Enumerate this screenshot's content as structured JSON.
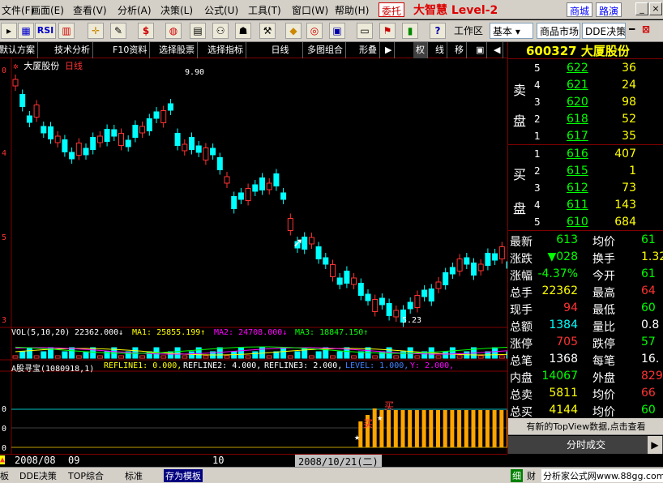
{
  "menubar": {
    "items": [
      "文件(F)",
      "画面(E)",
      "查看(V)",
      "分析(A)",
      "决策(L)",
      "公式(U)",
      "工具(T)",
      "窗口(W)",
      "帮助(H)"
    ],
    "entrust": "委托",
    "brand_title": "大智慧 Level-2",
    "mall": "商城",
    "roadshow": "路演"
  },
  "toolbar": {
    "rsi": "RSI",
    "dollar": "$",
    "workspace": "工作区",
    "basic_select": "基本",
    "market_select": "商品市场",
    "dde_select": "DDE决策"
  },
  "funcbar": {
    "items": [
      "默认方案",
      "技术分析",
      "F10资料",
      "选择股票",
      "选择指标",
      "日线",
      "多图组合",
      "形叠",
      "▶",
      "权",
      "线",
      "移",
      "▣",
      "◀"
    ]
  },
  "chart": {
    "stock_name": "大厦股份",
    "period": "日线",
    "high_label": "9.90",
    "low_label": "5.23",
    "axis_left_top": "0",
    "axis_left_mid": "4",
    "axis_left_lower": "5",
    "axis_left_bottom": "3",
    "vol_title": "VOL(5,10,20)",
    "vol_value": "22362.000↓",
    "ma1": "MA1: 25855.199↑",
    "ma2": "MA2: 24708.000↓",
    "ma3": "MA3: 18847.150↑",
    "ind_title": "A股寻宝(1080918,1)",
    "ref1": "REFLINE1: 0.000,",
    "ref2": "REFLINE2: 4.000,",
    "ref3": "REFLINE3: 2.000,",
    "level": "LEVEL: 1.000,",
    "y": "Y: 2.000,",
    "buy1": "买",
    "buy2": "买",
    "ind_axis_top": "0",
    "ind_axis_bottom": "0",
    "ind_axis_bot2": "0"
  },
  "datebar": {
    "d1": "2008/08",
    "d2": "09",
    "d3": "10",
    "cursor_date": "2008/10/21(二)"
  },
  "quote": {
    "code_name": "600327 大厦股份",
    "sell_label1": "卖",
    "sell_label2": "盘",
    "buy_label1": "买",
    "buy_label2": "盘",
    "asks": [
      {
        "lvl": "5",
        "price": "622",
        "vol": "36"
      },
      {
        "lvl": "4",
        "price": "621",
        "vol": "24"
      },
      {
        "lvl": "3",
        "price": "620",
        "vol": "98"
      },
      {
        "lvl": "2",
        "price": "618",
        "vol": "52"
      },
      {
        "lvl": "1",
        "price": "617",
        "vol": "35"
      }
    ],
    "bids": [
      {
        "lvl": "1",
        "price": "616",
        "vol": "407"
      },
      {
        "lvl": "2",
        "price": "615",
        "vol": "1"
      },
      {
        "lvl": "3",
        "price": "612",
        "vol": "73"
      },
      {
        "lvl": "4",
        "price": "611",
        "vol": "143"
      },
      {
        "lvl": "5",
        "price": "610",
        "vol": "684"
      }
    ],
    "stats": [
      {
        "l1": "最新",
        "v1": "613",
        "c1": "#00ff00",
        "l2": "均价",
        "v2": "61",
        "c2": "#00ff00"
      },
      {
        "l1": "涨跌",
        "v1": "▼028",
        "c1": "#00ff00",
        "l2": "换手",
        "v2": "1.32",
        "c2": "#ffff00"
      },
      {
        "l1": "涨幅",
        "v1": "-4.37%",
        "c1": "#00ff00",
        "l2": "今开",
        "v2": "61",
        "c2": "#00ff00"
      },
      {
        "l1": "总手",
        "v1": "22362",
        "c1": "#ffff00",
        "l2": "最高",
        "v2": "64",
        "c2": "#ff3333"
      },
      {
        "l1": "现手",
        "v1": "94",
        "c1": "#ff3333",
        "l2": "最低",
        "v2": "60",
        "c2": "#00ff00"
      },
      {
        "l1": "总额",
        "v1": "1384",
        "c1": "#00ffff",
        "l2": "量比",
        "v2": "0.8",
        "c2": "#ffffff"
      },
      {
        "l1": "涨停",
        "v1": "705",
        "c1": "#ff3333",
        "l2": "跌停",
        "v2": "57",
        "c2": "#00ff00"
      },
      {
        "l1": "总笔",
        "v1": "1368",
        "c1": "#ffffff",
        "l2": "每笔",
        "v2": "16.",
        "c2": "#ffffff"
      },
      {
        "l1": "内盘",
        "v1": "14067",
        "c1": "#00ff00",
        "l2": "外盘",
        "v2": "829",
        "c2": "#ff3333"
      },
      {
        "l1": "总卖",
        "v1": "5811",
        "c1": "#ffff00",
        "l2": "均价",
        "v2": "66",
        "c2": "#ff3333"
      },
      {
        "l1": "总买",
        "v1": "4144",
        "c1": "#ffff00",
        "l2": "均价",
        "v2": "60",
        "c2": "#00ff00"
      }
    ],
    "notice": "有新的TopView数据,点击查看",
    "timeshare": "分时成交"
  },
  "bottomtabs": {
    "t0": "板",
    "t1": "DDE决策",
    "t2": "TOP综合",
    "t3": "标准",
    "t4": "存为模板",
    "r1": "细",
    "r2": "财",
    "site": "分析家公式网www.88gg.com"
  }
}
